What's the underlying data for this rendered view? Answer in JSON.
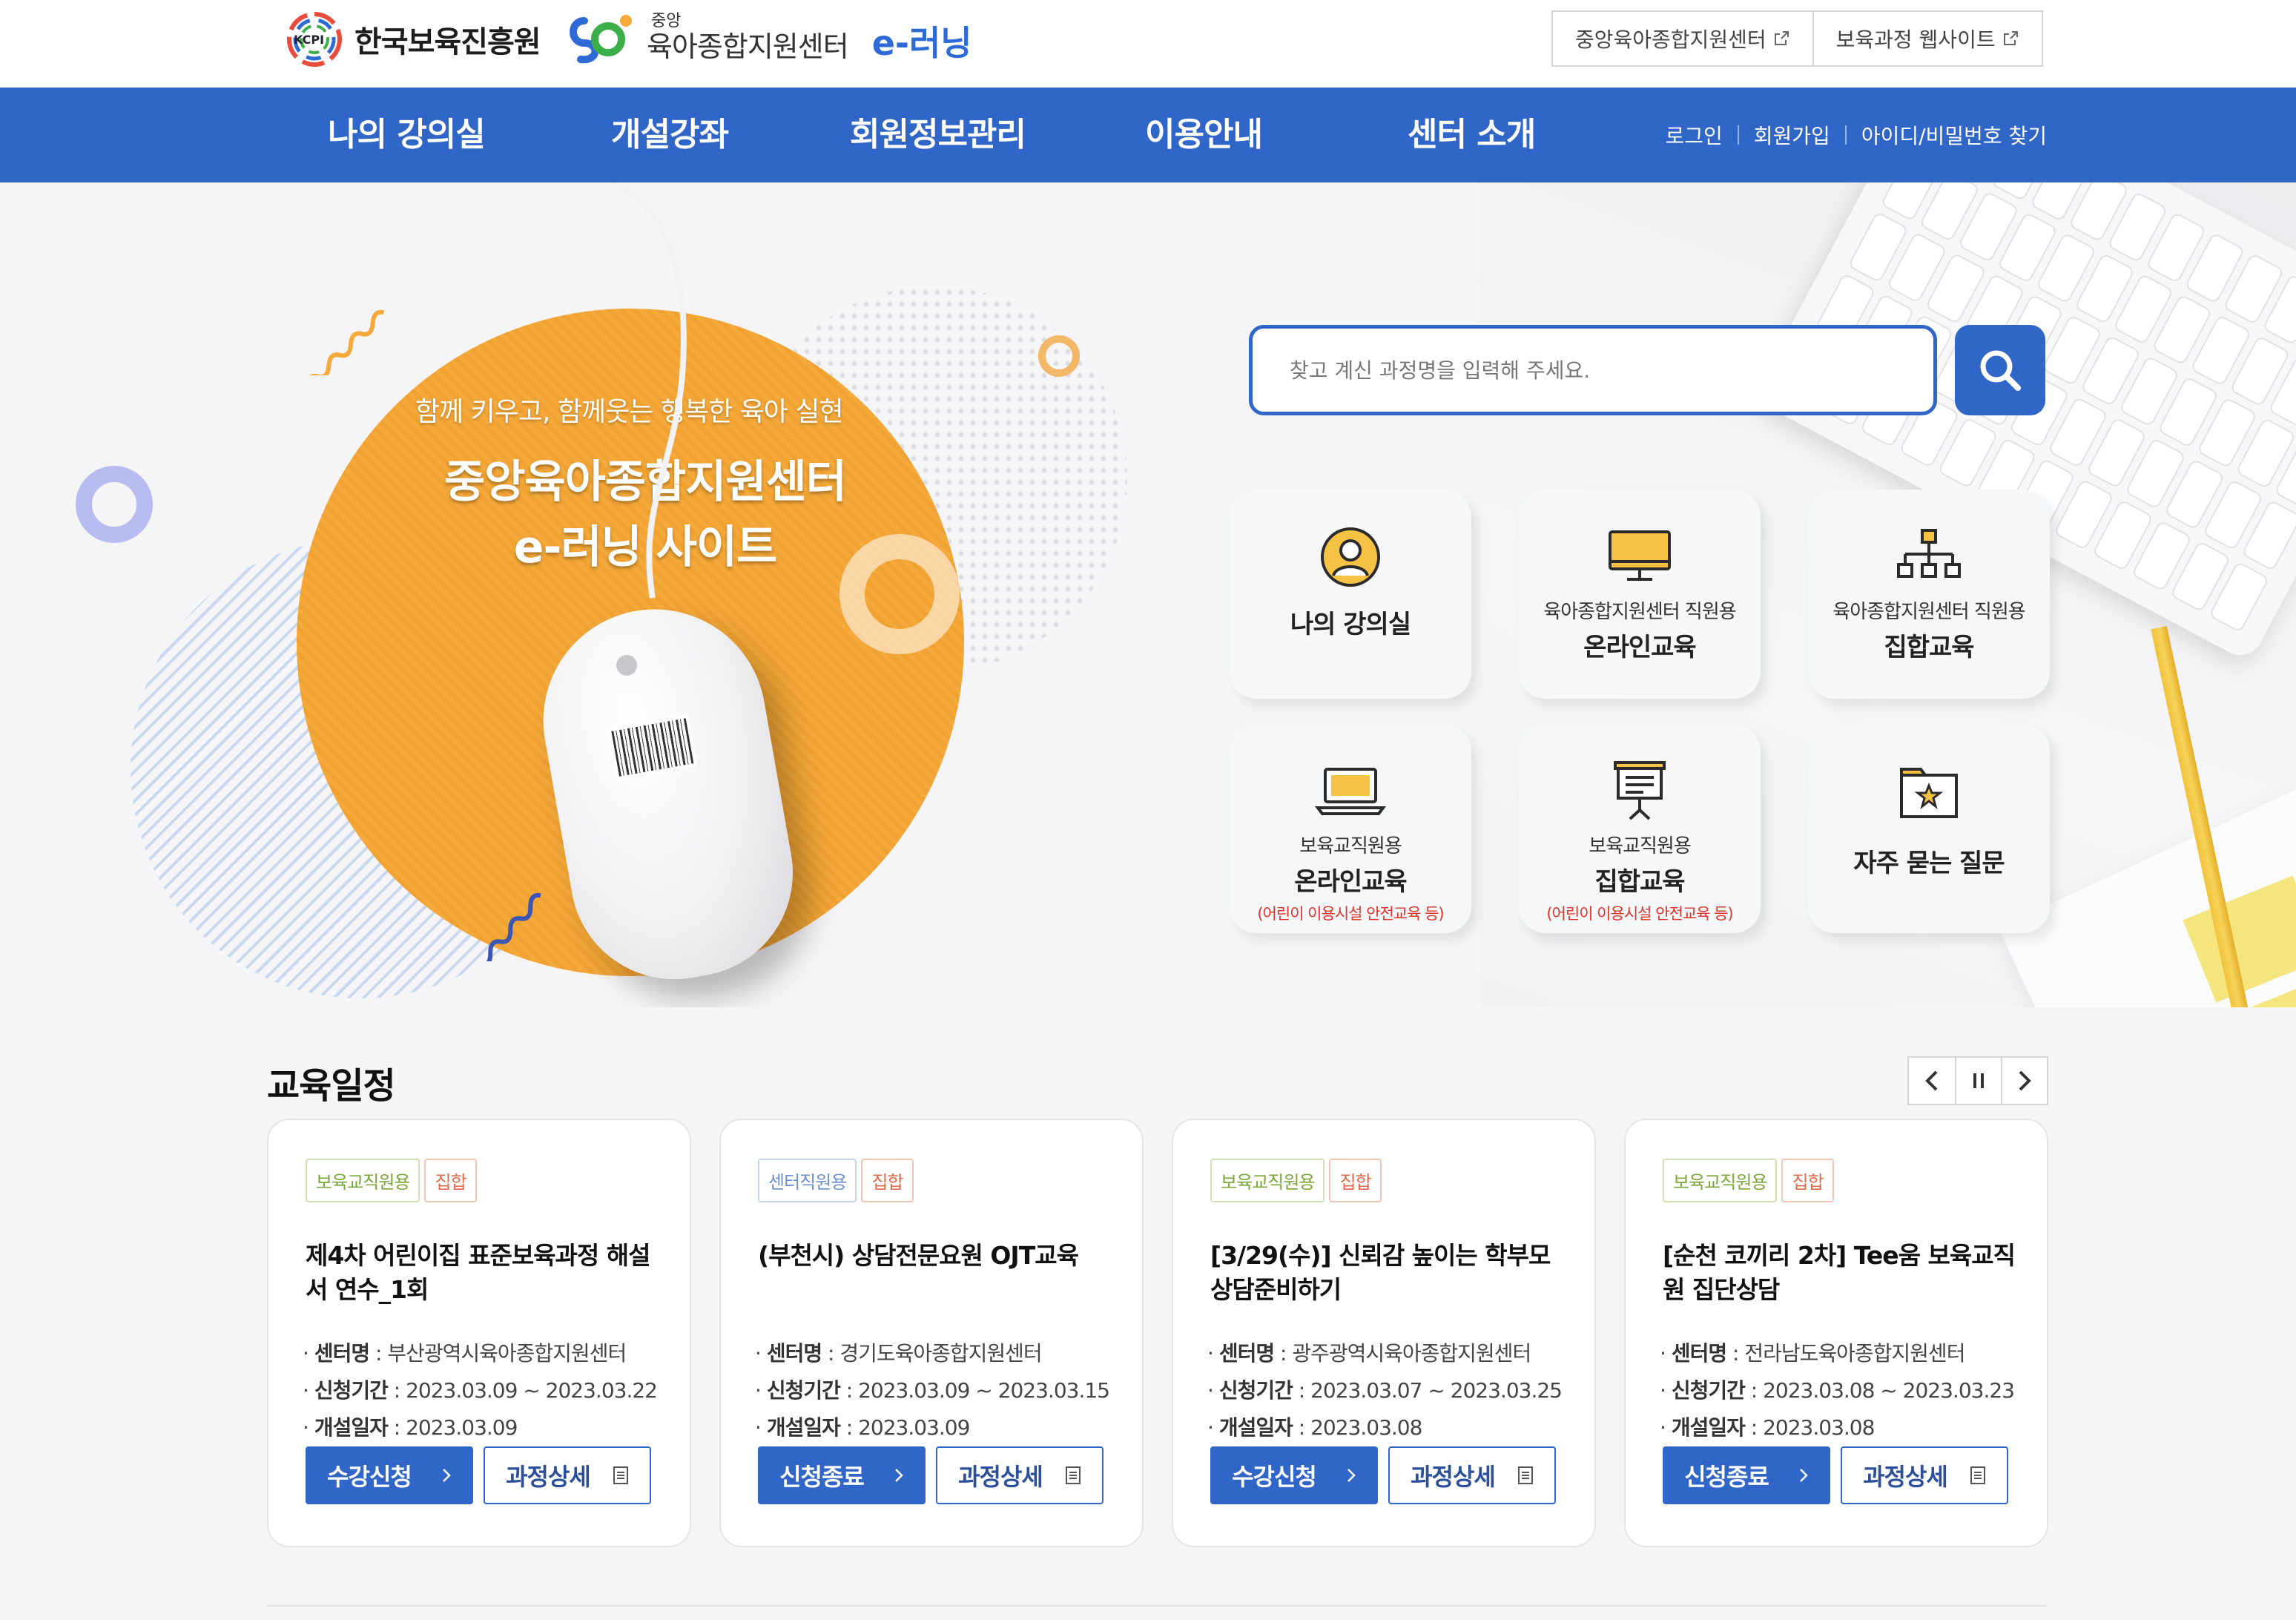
{
  "header": {
    "logo_kcpi_text": "한국보육진흥원",
    "logo_kcpi_mark": "KCPI",
    "logo_center_small": "중앙",
    "logo_center_text": "육아종합지원센터",
    "logo_center_el": "e-러닝",
    "ext_links": [
      {
        "label": "중앙육아종합지원센터",
        "icon": "external-link-icon"
      },
      {
        "label": "보육과정 웹사이트",
        "icon": "external-link-icon"
      }
    ]
  },
  "nav": {
    "items": [
      "나의 강의실",
      "개설강좌",
      "회원정보관리",
      "이용안내",
      "센터 소개"
    ],
    "util": [
      "로그인",
      "회원가입",
      "아이디/비밀번호 찾기"
    ]
  },
  "hero": {
    "subtitle": "함께 키우고, 함께웃는 행복한 육아 실현",
    "title_line1": "중앙육아종합지원센터",
    "title_line2": "e-러닝 사이트"
  },
  "search": {
    "placeholder": "찾고 계신 과정명을 입력해 주세요.",
    "button_icon": "search-icon"
  },
  "quick_links": [
    {
      "sub": "",
      "title": "나의 강의실",
      "note": "",
      "icon": "user-circle-icon"
    },
    {
      "sub": "육아종합지원센터 직원용",
      "title": "온라인교육",
      "note": "",
      "icon": "monitor-icon"
    },
    {
      "sub": "육아종합지원센터 직원용",
      "title": "집합교육",
      "note": "",
      "icon": "org-chart-icon"
    },
    {
      "sub": "보육교직원용",
      "title": "온라인교육",
      "note": "(어린이 이용시설 안전교육 등)",
      "icon": "laptop-icon"
    },
    {
      "sub": "보육교직원용",
      "title": "집합교육",
      "note": "(어린이 이용시설 안전교육 등)",
      "icon": "presentation-board-icon"
    },
    {
      "sub": "",
      "title": "자주 묻는 질문",
      "note": "",
      "icon": "star-folder-icon"
    }
  ],
  "schedule": {
    "title": "교육일정",
    "controls": {
      "prev": "‹",
      "pause": "II",
      "next": "›"
    },
    "labels": {
      "center": "센터명",
      "period": "신청기간",
      "open": "개설일자"
    },
    "cards": [
      {
        "tags": [
          {
            "text": "보육교직원용",
            "color": "green"
          },
          {
            "text": "집합",
            "color": "red"
          }
        ],
        "title": "제4차 어린이집 표준보육과정 해설서 연수_1회",
        "center": "부산광역시육아종합지원센터",
        "period": "2023.03.09 ~ 2023.03.22",
        "open": "2023.03.09",
        "primary": "수강신청",
        "secondary": "과정상세"
      },
      {
        "tags": [
          {
            "text": "센터직원용",
            "color": "blue"
          },
          {
            "text": "집합",
            "color": "red"
          }
        ],
        "title": "(부천시) 상담전문요원 OJT교육",
        "center": "경기도육아종합지원센터",
        "period": "2023.03.09 ~ 2023.03.15",
        "open": "2023.03.09",
        "primary": "신청종료",
        "secondary": "과정상세"
      },
      {
        "tags": [
          {
            "text": "보육교직원용",
            "color": "green"
          },
          {
            "text": "집합",
            "color": "red"
          }
        ],
        "title": "[3/29(수)] 신뢰감 높이는 학부모 상담준비하기",
        "center": "광주광역시육아종합지원센터",
        "period": "2023.03.07 ~ 2023.03.25",
        "open": "2023.03.08",
        "primary": "수강신청",
        "secondary": "과정상세"
      },
      {
        "tags": [
          {
            "text": "보육교직원용",
            "color": "green"
          },
          {
            "text": "집합",
            "color": "red"
          }
        ],
        "title": "[순천 코끼리 2차] Tee움 보육교직원 집단상담",
        "center": "전라남도육아종합지원센터",
        "period": "2023.03.08 ~ 2023.03.23",
        "open": "2023.03.08",
        "primary": "신청종료",
        "secondary": "과정상세"
      }
    ]
  },
  "colors": {
    "primary": "#3166c9",
    "accent_orange": "#f4a93a",
    "note_red": "#e0332c"
  }
}
